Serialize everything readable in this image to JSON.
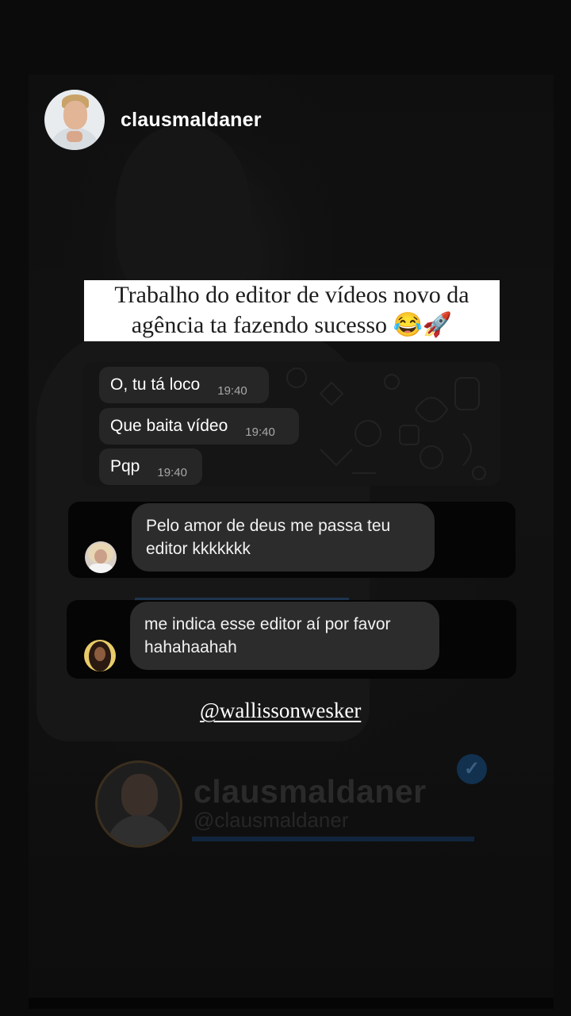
{
  "header": {
    "username": "clausmaldaner"
  },
  "caption": {
    "line1": "Trabalho do editor de vídeos novo da",
    "line2": "agência ta fazendo sucesso 😂🚀"
  },
  "whatsapp": {
    "messages": [
      {
        "text": "O, tu tá loco",
        "time": "19:40"
      },
      {
        "text": "Que baita vídeo",
        "time": "19:40"
      },
      {
        "text": "Pqp",
        "time": "19:40"
      }
    ]
  },
  "comments": [
    {
      "line1": "Pelo amor de deus me passa teu",
      "line2": "editor kkkkkkk"
    },
    {
      "line1": "me indica esse editor aí por favor",
      "line2": "hahahaahah"
    }
  ],
  "mention": "@wallissonwesker",
  "profile_card": {
    "name": "clausmaldaner",
    "handle": "@clausmaldaner",
    "verified_icon": "verified-badge-icon"
  },
  "colors": {
    "background": "#0b0b0b",
    "bubble": "#262626",
    "comment_bubble": "#2c2c2c",
    "verified": "#1877f2"
  }
}
